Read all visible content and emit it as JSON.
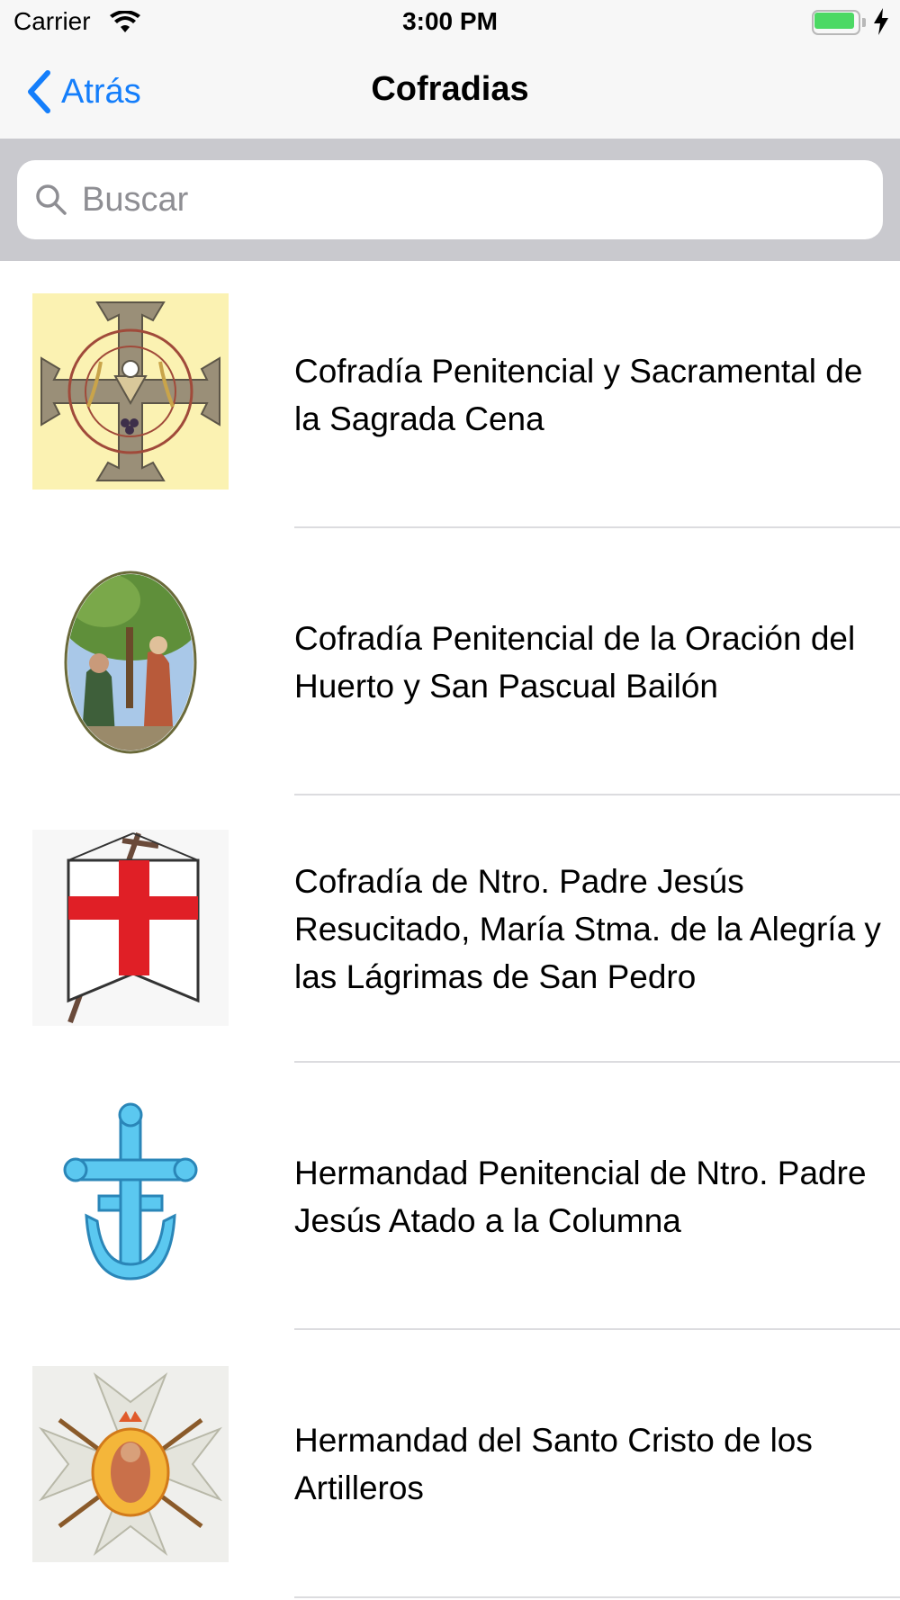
{
  "status_bar": {
    "carrier": "Carrier",
    "time": "3:00 PM",
    "battery_level": 1.0,
    "charging": true,
    "icons": [
      "wifi-icon",
      "battery-icon",
      "bolt-icon"
    ]
  },
  "nav_bar": {
    "back_label": "Atrás",
    "title": "Cofradias",
    "accent_color": "#147efb"
  },
  "search": {
    "placeholder": "Buscar",
    "value": ""
  },
  "cofradias": [
    {
      "name": "Cofradía Penitencial y Sacramental de la Sagrada Cena",
      "emblem": "sagrada-cena-cross-emblem"
    },
    {
      "name": "Cofradía Penitencial de la Oración del Huerto y San Pascual Bailón",
      "emblem": "oracion-huerto-oval-emblem"
    },
    {
      "name": "Cofradía de Ntro. Padre Jesús Resucitado, María Stma. de la Alegría y las Lágrimas de San Pedro",
      "emblem": "red-cross-banner-emblem"
    },
    {
      "name": "Hermandad Penitencial de Ntro. Padre Jesús Atado a la Columna",
      "emblem": "blue-cross-anchor-emblem"
    },
    {
      "name": "Hermandad del Santo Cristo de los Artilleros",
      "emblem": "maltese-cross-cristo-emblem"
    }
  ]
}
